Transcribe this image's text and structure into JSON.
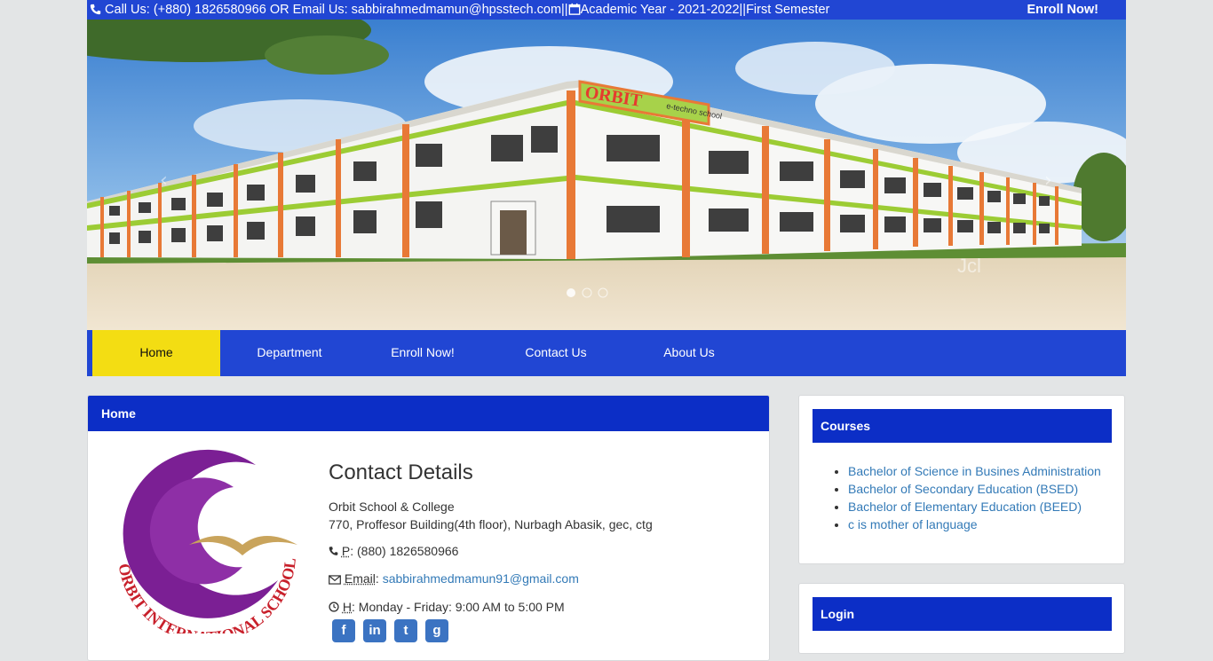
{
  "topbar": {
    "call_prefix": "Call Us: (+880) 1826580966 OR Email Us: sabbirahmedmamun@hpsstech.com||",
    "academic": "Academic Year - 2021-2022||First Semester",
    "enroll": "Enroll Now!"
  },
  "banner": {
    "school_sign": "ORBIT",
    "school_sub": "e-techno school",
    "watermark": "Jcl"
  },
  "nav": {
    "items": [
      "Home",
      "Department",
      "Enroll Now!",
      "Contact Us",
      "About Us"
    ],
    "active_index": 0
  },
  "main": {
    "heading": "Home",
    "logo_text": "ORBIT INTERNATIONAL SCHOOL",
    "contact": {
      "title": "Contact Details",
      "name": "Orbit School & College",
      "address": "770, Proffesor Building(4th floor), Nurbagh Abasik, gec, ctg",
      "phone_label": "P",
      "phone": "(880) 1826580966",
      "email_label": "Email",
      "email": "sabbirahmedmamun91@gmail.com",
      "hours_label": "H",
      "hours": "Monday - Friday: 9:00 AM to 5:00 PM"
    },
    "social": [
      "facebook-icon",
      "linkedin-icon",
      "twitter-icon",
      "google-plus-icon"
    ]
  },
  "courses": {
    "heading": "Courses",
    "items": [
      "Bachelor of Science in Busines Administration",
      "Bachelor of Secondary Education (BSED)",
      "Bachelor of Elementary Education (BEED)",
      "c is mother of language"
    ]
  },
  "login": {
    "heading": "Login"
  },
  "colors": {
    "primary": "#2146d3",
    "panel_head": "#0c2ec6",
    "active": "#f3dd13",
    "link": "#337ab7"
  }
}
